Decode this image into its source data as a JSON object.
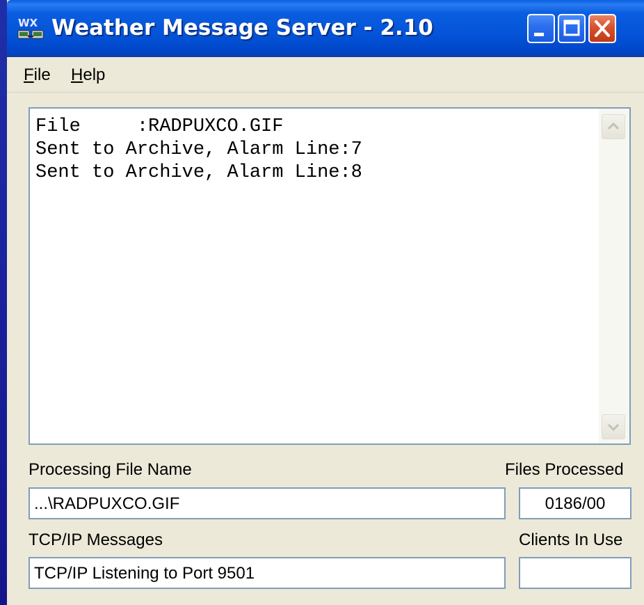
{
  "window": {
    "title": "Weather Message Server - 2.10",
    "icon": "wx-app-icon"
  },
  "titlebar_buttons": {
    "minimize": "minimize-icon",
    "maximize": "maximize-icon",
    "close": "close-icon"
  },
  "menu": {
    "file": {
      "accel": "F",
      "rest": "ile"
    },
    "help": {
      "accel": "H",
      "rest": "elp"
    }
  },
  "log": {
    "lines": [
      "File     :RADPUXCO.GIF",
      "Sent to Archive, Alarm Line:7",
      "Sent to Archive, Alarm Line:8"
    ]
  },
  "processing_file": {
    "label": "Processing File Name",
    "value": "...\\RADPUXCO.GIF"
  },
  "files_processed": {
    "label": "Files Processed",
    "value": "0186/00"
  },
  "tcp_messages": {
    "label": "TCP/IP Messages",
    "value": "TCP/IP Listening to Port 9501"
  },
  "clients_in_use": {
    "label": "Clients In Use",
    "value": ""
  },
  "colors": {
    "titlebar": "#0453d8",
    "close_button": "#d8512e",
    "window_face": "#ece9d8",
    "field_border": "#7f9db9"
  }
}
